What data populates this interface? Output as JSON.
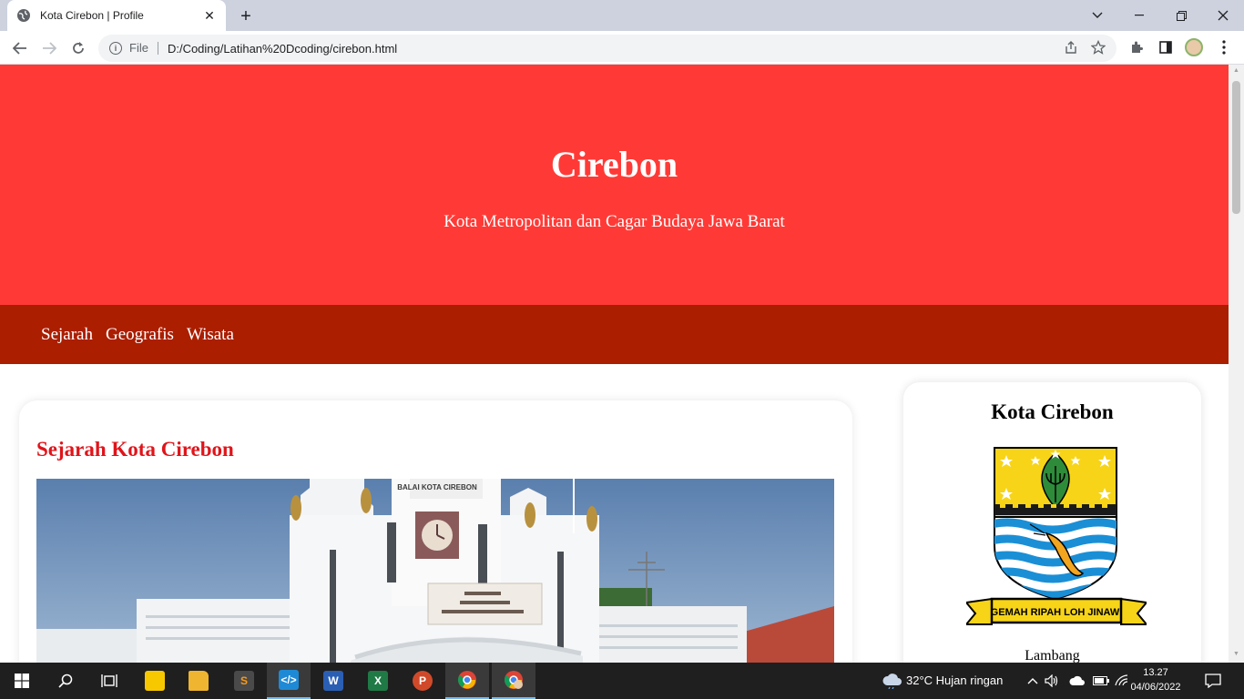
{
  "browser": {
    "tab_title": "Kota Cirebon | Profile",
    "tab_close": "✕",
    "new_tab": "+",
    "scheme_chip": "File",
    "url": "D:/Coding/Latihan%20Dcoding/cirebon.html"
  },
  "page": {
    "header": {
      "title": "Cirebon",
      "subtitle": "Kota Metropolitan dan Cagar Budaya Jawa Barat"
    },
    "nav": [
      {
        "label": "Sejarah"
      },
      {
        "label": "Geografis"
      },
      {
        "label": "Wisata"
      }
    ],
    "article": {
      "title": "Sejarah Kota Cirebon",
      "photo_sign": "BALAI KOTA CIREBON"
    },
    "sidebar": {
      "title": "Kota Cirebon",
      "emblem_motto": "GEMAH RIPAH LOH JINAWI",
      "caption": "Lambang"
    }
  },
  "taskbar": {
    "weather": "32°C  Hujan ringan",
    "time": "13.27",
    "date": "04/06/2022"
  },
  "colors": {
    "header_bg": "#ff3a36",
    "nav_bg": "#ab1e00",
    "article_title": "#e0141a"
  }
}
